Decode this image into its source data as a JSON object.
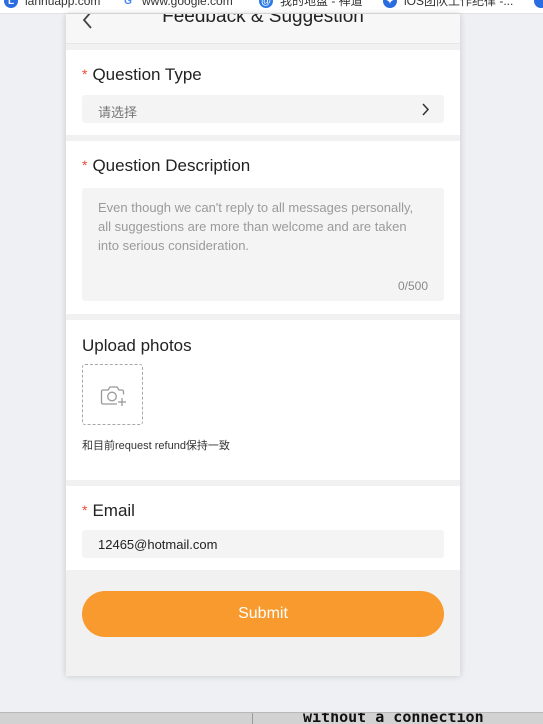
{
  "bookmarks": [
    {
      "label": "lanhuapp.com",
      "icon": "lanhu-icon",
      "color": "#2a6de0"
    },
    {
      "label": "www.google.com",
      "icon": "google-icon",
      "color": "#4285f4"
    },
    {
      "label": "我的地盘 - 禅道",
      "icon": "zentao-icon",
      "color": "#2d7be5"
    },
    {
      "label": "iOS团队工作纪律 -...",
      "icon": "doc-icon",
      "color": "#2a6de0"
    }
  ],
  "nav": {
    "title": "Feedback & Suggestion"
  },
  "question_type": {
    "required_mark": "*",
    "label": "Question Type",
    "select_value": "请选择"
  },
  "question_description": {
    "required_mark": "*",
    "label": "Question Description",
    "placeholder": "Even though we can't reply to all messages personally, all suggestions are more than welcome and are taken into serious consideration.",
    "counter": "0/500"
  },
  "upload": {
    "label": "Upload photos",
    "hint": "和目前request refund保持一致"
  },
  "email": {
    "required_mark": "*",
    "label": "Email",
    "value": "12465@hotmail.com"
  },
  "submit": {
    "label": "Submit"
  },
  "background_window": {
    "text": "without a connection"
  },
  "colors": {
    "accent": "#f89a2e",
    "required": "#f04a3a"
  }
}
